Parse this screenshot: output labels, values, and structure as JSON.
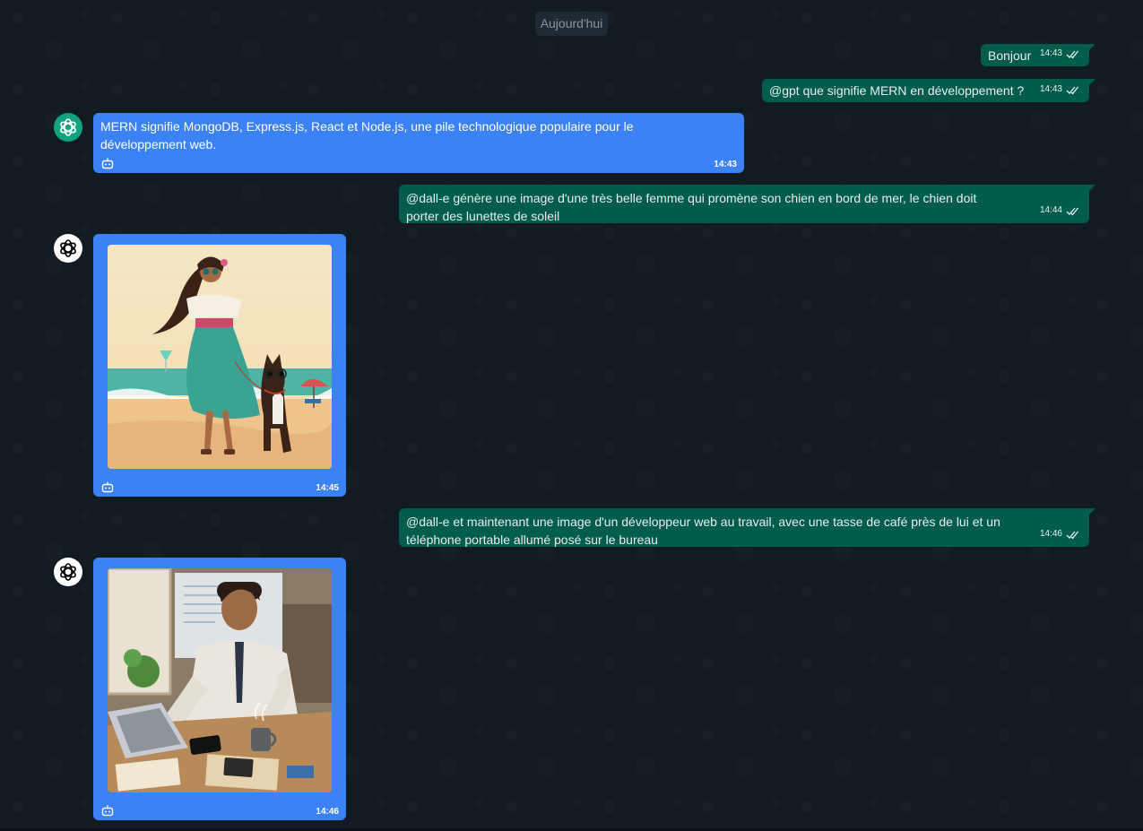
{
  "chat": {
    "date_chip": "Aujourd'hui",
    "messages": [
      {
        "text": "Bonjour",
        "time": "14:43"
      },
      {
        "text": "@gpt que signifie MERN en développement ?",
        "time": "14:43"
      },
      {
        "text": "MERN signifie MongoDB, Express.js, React et Node.js, une pile technologique populaire pour le\ndéveloppement web.",
        "time": "14:43"
      },
      {
        "text": "@dall-e génère une image d'une très belle femme qui promène son chien en bord de mer, le chien doit\nporter des lunettes de soleil",
        "time": "14:44"
      },
      {
        "image": "beach-woman-dog",
        "time": "14:45"
      },
      {
        "text": "@dall-e et maintenant une image d'un développeur web au travail, avec une tasse de café près de lui et un\ntéléphone portable allumé posé sur le bureau",
        "time": "14:46"
      },
      {
        "image": "developer-at-desk",
        "time": "14:46"
      }
    ]
  },
  "colors": {
    "background": "#121b22",
    "outgoing_bubble": "#005c4b",
    "bot_bubble": "#3b82f6",
    "gpt_avatar": "#10a37f",
    "dalle_avatar": "#ffffff"
  },
  "icons": {
    "gpt_avatar": "openai-icon",
    "dalle_avatar": "openai-icon",
    "bot_indicator": "robot-icon",
    "read_receipt": "double-check-icon"
  }
}
